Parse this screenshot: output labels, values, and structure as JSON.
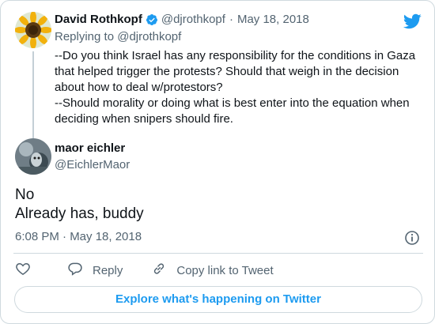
{
  "parent_tweet": {
    "author_name": "David Rothkopf",
    "handle": "@djrothkopf",
    "separator": "·",
    "date": "May 18, 2018",
    "replying_to": "Replying to @djrothkopf",
    "text": "--Do you think Israel has any responsibility for the conditions in Gaza that helped trigger the protests?  Should that weigh in the decision about how to deal w/protestors?\n--Should morality or doing what is best enter into the equation when deciding when snipers should fire."
  },
  "main_tweet": {
    "author_name": "maor eichler",
    "handle": "@EichlerMaor",
    "text": "No\nAlready has, buddy",
    "timestamp": "6:08 PM · May 18, 2018"
  },
  "actions": {
    "reply_label": "Reply",
    "copy_label": "Copy link to Tweet"
  },
  "explore_label": "Explore what's happening on Twitter",
  "icons": {
    "verified": "verified-badge-icon",
    "twitter": "twitter-bird-icon",
    "info": "info-icon",
    "like": "heart-icon",
    "reply": "speech-bubble-icon",
    "copy": "link-icon"
  },
  "colors": {
    "accent": "#1d9bf0",
    "muted": "#536471",
    "text": "#0f1419",
    "border": "#cfd9de"
  }
}
